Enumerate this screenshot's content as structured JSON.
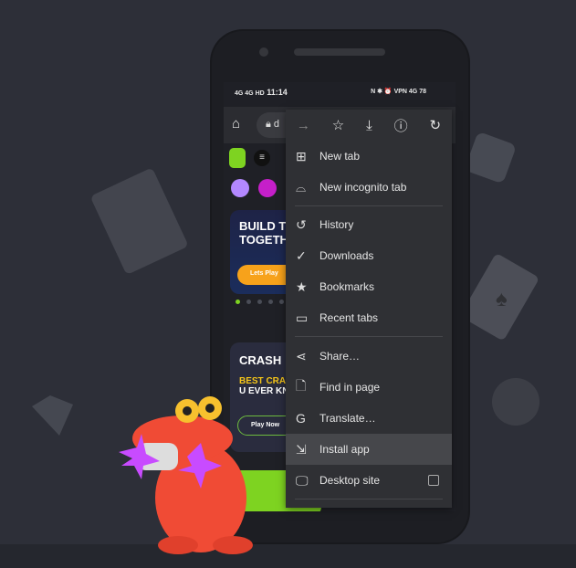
{
  "status_bar": {
    "time": "11:14",
    "left_icons": "4G 4G HD",
    "right_icons": "N ✱ ⏰ VPN 4G 78"
  },
  "toolbar": {
    "url_text": "d",
    "home_icon": "home-icon",
    "lock_icon": "lock-icon"
  },
  "menu": {
    "top_icons": [
      "forward-icon",
      "star-icon",
      "download-icon",
      "info-icon",
      "refresh-icon"
    ],
    "items": [
      {
        "label": "New tab",
        "icon": "new-tab-icon"
      },
      {
        "label": "New incognito tab",
        "icon": "incognito-icon"
      },
      {
        "label": "History",
        "icon": "history-icon"
      },
      {
        "label": "Downloads",
        "icon": "downloads-icon"
      },
      {
        "label": "Bookmarks",
        "icon": "star-icon"
      },
      {
        "label": "Recent tabs",
        "icon": "devices-icon"
      },
      {
        "label": "Share…",
        "icon": "share-icon"
      },
      {
        "label": "Find in page",
        "icon": "find-icon"
      },
      {
        "label": "Translate…",
        "icon": "translate-icon"
      },
      {
        "label": "Install app",
        "icon": "install-icon"
      },
      {
        "label": "Desktop site",
        "icon": "desktop-icon"
      }
    ],
    "highlighted": "Install app",
    "desktop_site_checked": false
  },
  "page": {
    "banner_title_1": "BUILD T",
    "banner_title_2": "TOGETH",
    "banner_button": "Lets Play",
    "crash_title": "CRASH",
    "crash_sub_1": "BEST CRAS",
    "crash_sub_2": "U EVER KN",
    "play_button": "Play Now"
  },
  "colors": {
    "accent_green": "#7ed321",
    "button_orange": "#f7a21b",
    "menu_bg": "#2f3034"
  }
}
